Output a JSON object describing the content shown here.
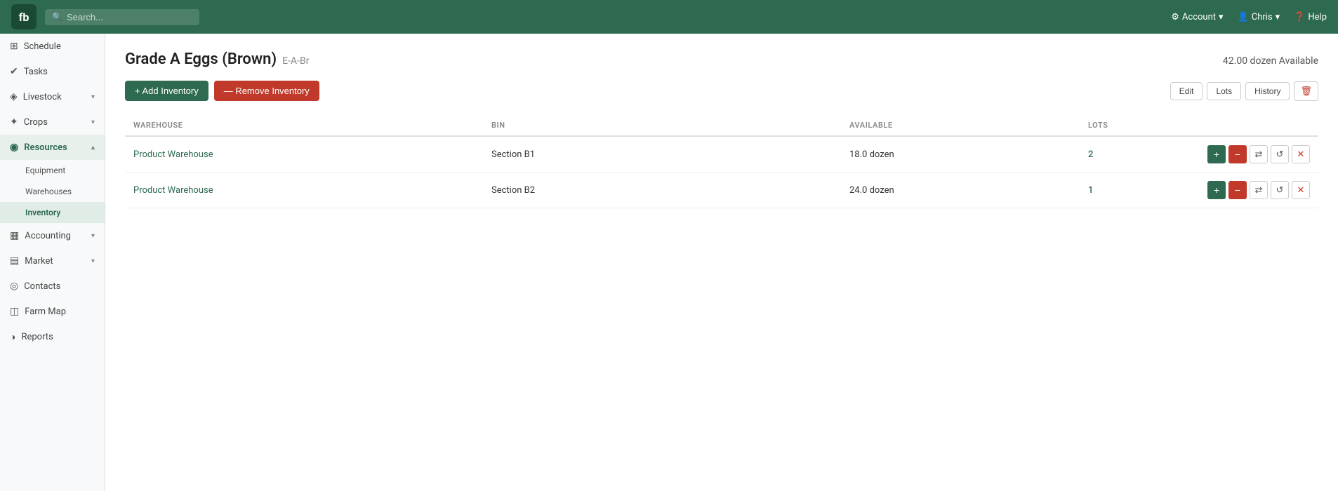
{
  "app": {
    "logo": "fb",
    "search_placeholder": "Search..."
  },
  "nav_right": {
    "account_label": "Account",
    "user_label": "Chris",
    "help_label": "Help"
  },
  "sidebar": {
    "items": [
      {
        "id": "schedule",
        "label": "Schedule",
        "icon": "⊞",
        "active": false,
        "expandable": false
      },
      {
        "id": "tasks",
        "label": "Tasks",
        "icon": "✓",
        "active": false,
        "expandable": false
      },
      {
        "id": "livestock",
        "label": "Livestock",
        "icon": "🐄",
        "active": false,
        "expandable": true
      },
      {
        "id": "crops",
        "label": "Crops",
        "icon": "🌿",
        "active": false,
        "expandable": true
      },
      {
        "id": "resources",
        "label": "Resources",
        "icon": "⚙",
        "active": true,
        "expandable": true,
        "subitems": [
          {
            "id": "equipment",
            "label": "Equipment",
            "active": false
          },
          {
            "id": "warehouses",
            "label": "Warehouses",
            "active": false
          },
          {
            "id": "inventory",
            "label": "Inventory",
            "active": true
          }
        ]
      },
      {
        "id": "accounting",
        "label": "Accounting",
        "icon": "📊",
        "active": false,
        "expandable": true
      },
      {
        "id": "market",
        "label": "Market",
        "icon": "🏪",
        "active": false,
        "expandable": true
      },
      {
        "id": "contacts",
        "label": "Contacts",
        "icon": "👥",
        "active": false,
        "expandable": false
      },
      {
        "id": "farm-map",
        "label": "Farm Map",
        "icon": "🗺",
        "active": false,
        "expandable": false
      },
      {
        "id": "reports",
        "label": "Reports",
        "icon": "📄",
        "active": false,
        "expandable": false
      }
    ]
  },
  "page": {
    "title": "Grade A Eggs (Brown)",
    "code": "E-A-Br",
    "available_text": "42.00 dozen Available"
  },
  "actions": {
    "add_inventory": "+ Add Inventory",
    "remove_inventory": "— Remove Inventory",
    "edit": "Edit",
    "lots": "Lots",
    "history": "History"
  },
  "table": {
    "columns": {
      "warehouse": "WAREHOUSE",
      "bin": "BIN",
      "available": "AVAILABLE",
      "lots": "LOTS"
    },
    "rows": [
      {
        "warehouse": "Product Warehouse",
        "bin": "Section B1",
        "available": "18.0 dozen",
        "lots": "2"
      },
      {
        "warehouse": "Product Warehouse",
        "bin": "Section B2",
        "available": "24.0 dozen",
        "lots": "1"
      }
    ]
  }
}
